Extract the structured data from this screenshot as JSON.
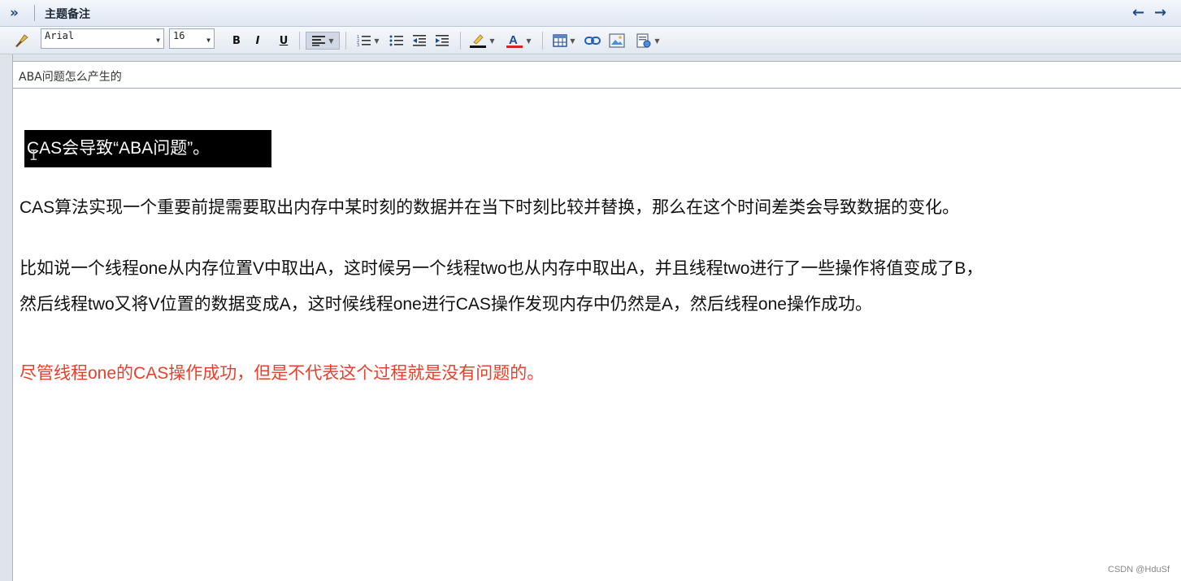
{
  "panel": {
    "title": "主题备注"
  },
  "toolbar": {
    "font_family": "Arial",
    "font_size": "16",
    "bold": "B",
    "italic": "I",
    "underline": "U"
  },
  "subject": "ABA问题怎么产生的",
  "content": {
    "highlight": "CAS会导致“ABA问题”。",
    "para1": "CAS算法实现一个重要前提需要取出内存中某时刻的数据并在当下时刻比较并替换，那么在这个时间差类会导致数据的变化。",
    "para2_line1": "比如说一个线程one从内存位置V中取出A，这时候另一个线程two也从内存中取出A，并且线程two进行了一些操作将值变成了B，",
    "para2_line2": "然后线程two又将V位置的数据变成A，这时候线程one进行CAS操作发现内存中仍然是A，然后线程one操作成功。",
    "para3": "尽管线程one的CAS操作成功，但是不代表这个过程就是没有问题的。"
  },
  "watermark": "CSDN @HduSf",
  "colors": {
    "highlight_bg": "#000000",
    "warning_text": "#e8402c",
    "accent": "#1e4b8f"
  }
}
